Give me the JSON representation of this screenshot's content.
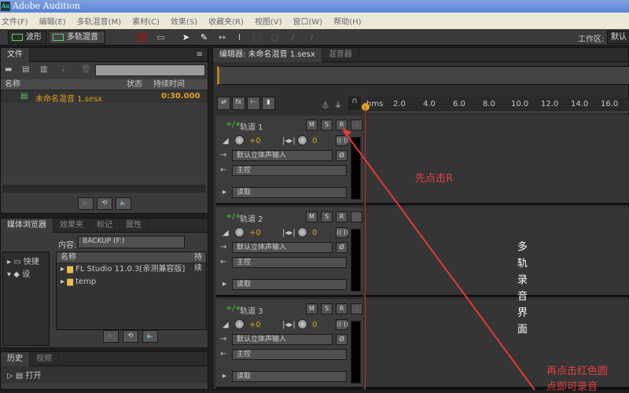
{
  "app": {
    "title": "Adobe Audition",
    "logo": "Au"
  },
  "menu": [
    "文件(F)",
    "编辑(E)",
    "多轨混音(M)",
    "素材(C)",
    "效果(S)",
    "收藏夹(R)",
    "视图(V)",
    "窗口(W)",
    "帮助(H)"
  ],
  "toolbar": {
    "waveform": "波形",
    "multitrack": "多轨混音",
    "workspace_label": "工作区:",
    "workspace_value": "默认"
  },
  "files_panel": {
    "tab": "文件",
    "search_placeholder": "",
    "columns": [
      "名称",
      "状态",
      "持续时间"
    ],
    "rows": [
      {
        "name": "未命名混音 1.sesx",
        "duration": "0:30.000"
      }
    ]
  },
  "media_panel": {
    "tabs": [
      "媒体浏览器",
      "效果夹",
      "标记",
      "属性"
    ],
    "content_label": "内容:",
    "content_value": "BACKUP (F:)",
    "columns": [
      "名称",
      "持续"
    ],
    "tree": [
      "快捷",
      "设"
    ],
    "rows": [
      "FL Studio 11.0.3[亲测兼容版]",
      "temp"
    ]
  },
  "history_panel": {
    "tabs": [
      "历史",
      "视频"
    ],
    "items": [
      "打开"
    ]
  },
  "editor": {
    "tabs": [
      "编辑器: 未命名混音 1.sesx",
      "混音器"
    ],
    "ruler": [
      "hms",
      "2.0",
      "4.0",
      "6.0",
      "8.0",
      "10.0",
      "12.0",
      "14.0",
      "16.0"
    ],
    "tracks": [
      {
        "name": "轨道 1",
        "volume": "+0",
        "pan": "0",
        "input": "默认立体声输入",
        "output": "主控",
        "automation": "读取"
      },
      {
        "name": "轨道 2",
        "volume": "+0",
        "pan": "0",
        "input": "默认立体声输入",
        "output": "主控",
        "automation": "读取"
      },
      {
        "name": "轨道 3",
        "volume": "+0",
        "pan": "0",
        "input": "默认立体声输入",
        "output": "主控",
        "automation": "读取"
      }
    ],
    "buttons": {
      "m": "M",
      "s": "S",
      "r": "R"
    }
  },
  "annotations": {
    "first": "先点击R",
    "vertical": [
      "多",
      "轨",
      "录",
      "音",
      "界",
      "面"
    ],
    "second_1": "再点击红色圆",
    "second_2": "点即可录音"
  },
  "colors": {
    "accent": "#e0a020",
    "annotation": "#e04040"
  }
}
